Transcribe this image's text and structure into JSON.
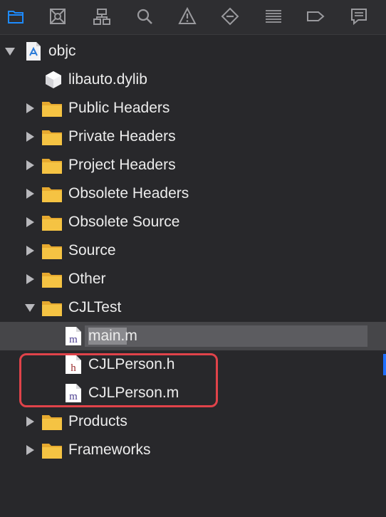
{
  "toolbar": {
    "items": [
      {
        "name": "project-navigator-icon",
        "active": true
      },
      {
        "name": "source-control-icon"
      },
      {
        "name": "symbol-navigator-icon"
      },
      {
        "name": "find-navigator-icon"
      },
      {
        "name": "issue-navigator-icon"
      },
      {
        "name": "test-navigator-icon"
      },
      {
        "name": "debug-navigator-icon"
      },
      {
        "name": "breakpoint-navigator-icon"
      },
      {
        "name": "report-navigator-icon"
      }
    ],
    "accent": "#1d8bff"
  },
  "tree": {
    "root": {
      "label": "objc",
      "expanded": true
    },
    "library": {
      "label": "libauto.dylib"
    },
    "groups": [
      {
        "label": "Public Headers",
        "expanded": false
      },
      {
        "label": "Private Headers",
        "expanded": false
      },
      {
        "label": "Project Headers",
        "expanded": false
      },
      {
        "label": "Obsolete Headers",
        "expanded": false
      },
      {
        "label": "Obsolete Source",
        "expanded": false
      },
      {
        "label": "Source",
        "expanded": false
      },
      {
        "label": "Other",
        "expanded": false
      },
      {
        "label": "CJLTest",
        "expanded": true
      }
    ],
    "files": [
      {
        "label": "main.m",
        "type_letter": "m",
        "editing": true
      },
      {
        "label": "CJLPerson.h",
        "type_letter": "h"
      },
      {
        "label": "CJLPerson.m",
        "type_letter": "m"
      }
    ],
    "after": [
      {
        "label": "Products",
        "expanded": false
      },
      {
        "label": "Frameworks",
        "expanded": false
      }
    ]
  },
  "colors": {
    "folder": "#f5c343",
    "highlight_border": "#e0434a",
    "h_letter": "#9b2d2d",
    "m_letter": "#4a3d8f"
  }
}
